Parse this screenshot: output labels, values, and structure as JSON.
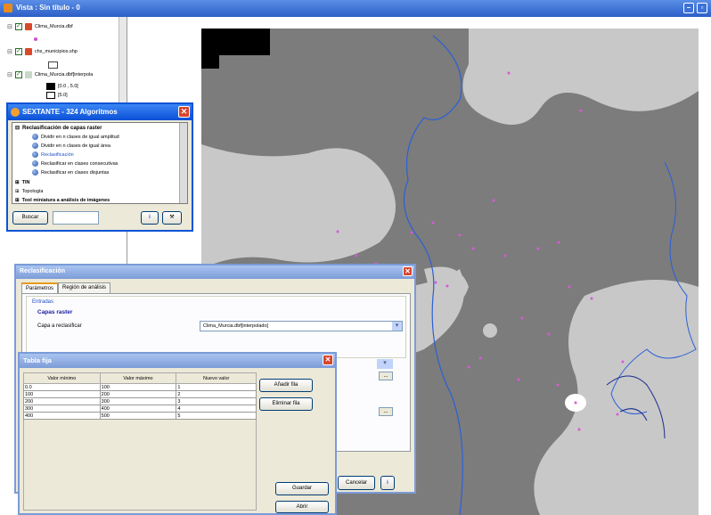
{
  "window": {
    "title": "Vista : Sin título - 0"
  },
  "toc": {
    "layers": [
      {
        "name": "Clima_Murcia.dbf"
      },
      {
        "name": "chs_municipios.shp"
      },
      {
        "name": "Clima_Murcia.dbf[interpola"
      }
    ],
    "legend": [
      {
        "label": "[0.0 , 5.0[",
        "color": "#000000"
      },
      {
        "label": "[5.0]",
        "color": "#ffffff"
      }
    ]
  },
  "sextante": {
    "title": "SEXTANTE - 324 Algoritmos",
    "group": "Reclasificación de capas raster",
    "items": [
      "Dividir en n clases de igual amplitud",
      "Dividir en n clases de igual área",
      "Reclasificación",
      "Reclasificar en clases consecutivas",
      "Reclasificar en clases disjuntas"
    ],
    "other_groups": [
      "TIN",
      "Topología",
      "Tool miniatura a análisis de imágenes"
    ],
    "search_button": "Buscar"
  },
  "reclasificacion": {
    "title": "Reclasificación",
    "tabs": [
      "Parámetros",
      "Región de análisis"
    ],
    "section_entradas": "Entradas",
    "section_capas": "Capas raster",
    "capa_label": "Capa a reclasificar",
    "capa_value": "Clima_Murcia.dbf[interpolado]",
    "cancel_button": "Cancelar"
  },
  "tabla_fija": {
    "title": "Tabla fija",
    "columns": [
      "Valor mínimo",
      "Valor máximo",
      "Nuevo valor"
    ],
    "rows": [
      [
        "0.0",
        "100",
        "1"
      ],
      [
        "100",
        "200",
        "2"
      ],
      [
        "200",
        "300",
        "3"
      ],
      [
        "300",
        "400",
        "4"
      ],
      [
        "400",
        "500",
        "5"
      ]
    ],
    "buttons": {
      "add_row": "Añadir fila",
      "delete_row": "Eliminar fila",
      "save": "Guardar",
      "open": "Abrir"
    }
  }
}
